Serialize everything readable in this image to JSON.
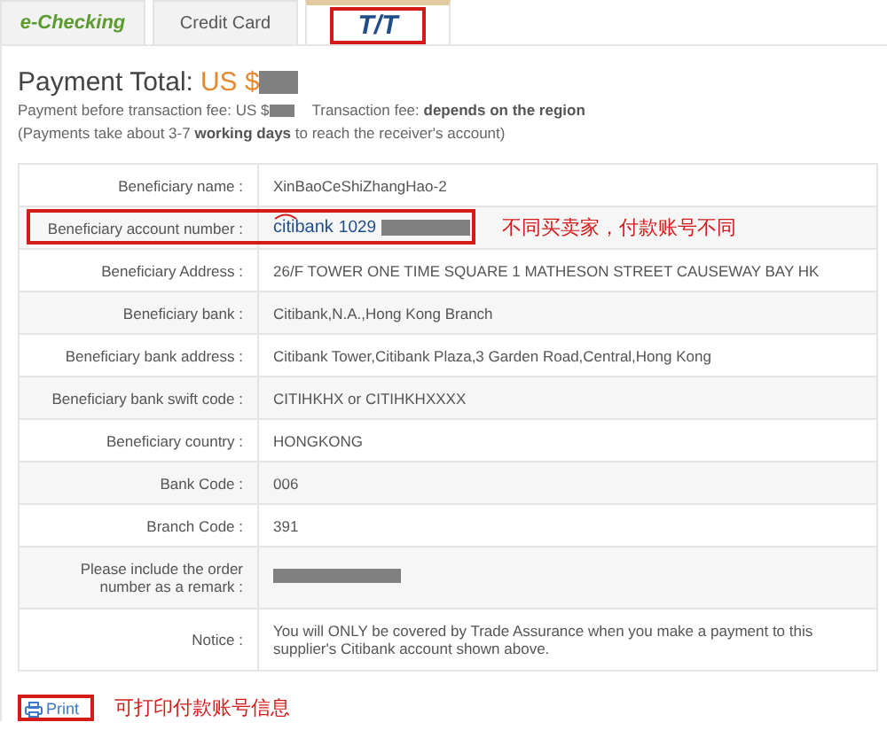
{
  "tabs": [
    {
      "label": "e-Checking",
      "kind": "echeck",
      "selected": false,
      "highlighted": false
    },
    {
      "label": "Credit Card",
      "kind": "plain",
      "selected": false,
      "highlighted": false
    },
    {
      "label": "T/T",
      "kind": "tt",
      "selected": true,
      "highlighted": true
    }
  ],
  "payment_total": {
    "label": "Payment Total:",
    "currency": "US $",
    "redacted": true
  },
  "fee_line": {
    "before_label": "Payment before transaction fee: US $",
    "before_redacted": true,
    "fee_label": "Transaction fee:",
    "fee_value": "depends on the region"
  },
  "timing_note": "(Payments take about 3-7 **working days** to reach the receiver's account)",
  "rows": [
    {
      "label": "Beneficiary name :",
      "value": "XinBaoCeShiZhangHao-2",
      "kind": "text"
    },
    {
      "label": "Beneficiary account number :",
      "logo": "citibank",
      "value": "1029",
      "redacted": true,
      "kind": "account",
      "highlighted": true,
      "note": "不同买卖家，付款账号不同"
    },
    {
      "label": "Beneficiary Address :",
      "value": "26/F TOWER ONE TIME SQUARE 1 MATHESON STREET CAUSEWAY BAY HK",
      "kind": "text"
    },
    {
      "label": "Beneficiary bank :",
      "value": "Citibank,N.A.,Hong Kong Branch",
      "kind": "text"
    },
    {
      "label": "Beneficiary bank address :",
      "value": "Citibank Tower,Citibank Plaza,3 Garden Road,Central,Hong Kong",
      "kind": "text"
    },
    {
      "label": "Beneficiary bank swift code :",
      "value": "CITIHKHX or CITIHKHXXXX",
      "kind": "text"
    },
    {
      "label": "Beneficiary country :",
      "value": "HONGKONG",
      "kind": "text"
    },
    {
      "label": "Bank Code :",
      "value": "006",
      "kind": "text"
    },
    {
      "label": "Branch Code :",
      "value": "391",
      "kind": "text"
    },
    {
      "label": "Please include the order number as a remark :",
      "redacted": true,
      "kind": "redacted"
    },
    {
      "label": "Notice :",
      "value": "You will ONLY be covered by Trade Assurance when you make a payment to this supplier's Citibank account shown above.",
      "kind": "text"
    }
  ],
  "print": {
    "label": "Print",
    "highlighted": true,
    "note": "可打印付款账号信息"
  }
}
